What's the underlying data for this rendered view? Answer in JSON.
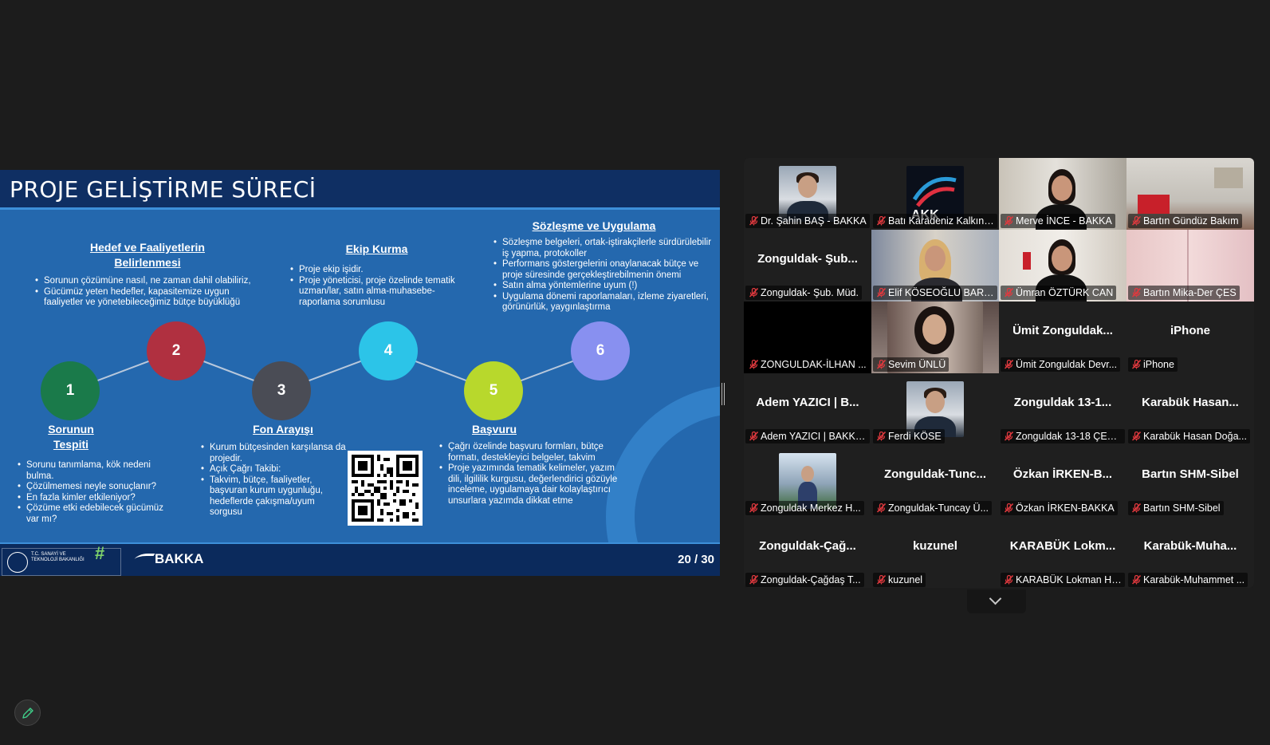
{
  "slide": {
    "title": "PROJE GELİŞTİRME SÜRECİ",
    "page": "20 / 30",
    "footer_ministry": "T.C. SANAYİ VE TEKNOLOJİ BAKANLIĞI",
    "footer_logo": "BAKKA",
    "steps": [
      {
        "num": "1",
        "title": "Sorunun Tespiti",
        "color": "#1a7a4a",
        "items": [
          "Sorunu tanımlama, kök nedeni bulma.",
          "Çözülmemesi neyle sonuçlanır?",
          "En fazla kimler etkileniyor?",
          "Çözüme etki edebilecek gücümüz var mı?"
        ]
      },
      {
        "num": "2",
        "title": "Hedef ve Faaliyetlerin Belirlenmesi",
        "color": "#b03040",
        "items": [
          "Sorunun çözümüne nasıl, ne zaman dahil olabiliriz,",
          "Gücümüz yeten hedefler, kapasitemize uygun faaliyetler ve yönetebileceğimiz bütçe büyüklüğü"
        ]
      },
      {
        "num": "3",
        "title": "Fon Arayışı",
        "color": "#4a4c55",
        "items": [
          "Kurum bütçesinden karşılansa da projedir.",
          "Açık Çağrı Takibi:",
          "Takvim, bütçe, faaliyetler, başvuran kurum uygunluğu, hedeflerde çakışma/uyum sorgusu"
        ]
      },
      {
        "num": "4",
        "title": "Ekip Kurma",
        "color": "#2cc4e8",
        "items": [
          "Proje ekip işidir.",
          "Proje yöneticisi, proje özelinde tematik uzman/lar, satın alma-muhasebe-raporlama sorumlusu"
        ]
      },
      {
        "num": "5",
        "title": "Başvuru",
        "color": "#b8d82c",
        "items": [
          "Çağrı özelinde başvuru formları, bütçe formatı, destekleyici belgeler, takvim",
          "Proje yazımında tematik kelimeler, yazım dili, ilgililik kurgusu, değerlendirici gözüyle inceleme, uygulamaya dair kolaylaştırıcı unsurlara yazımda dikkat etme"
        ]
      },
      {
        "num": "6",
        "title": "Sözleşme ve Uygulama",
        "color": "#8890f0",
        "items": [
          "Sözleşme belgeleri, ortak-iştirakçilerle sürdürülebilir iş yapma, protokoller",
          "Performans göstergelerini onaylanacak bütçe ve proje süresinde gerçekleştirebilmenin önemi",
          "Satın alma yöntemlerine uyum (!)",
          "Uygulama dönemi raporlamaları, izleme ziyaretleri, görünürlük, yaygınlaştırma"
        ]
      }
    ]
  },
  "participants": [
    {
      "big": "",
      "label": "Dr. Şahin BAŞ - BAKKA",
      "kind": "avatar-man"
    },
    {
      "big": "",
      "label": "Batı Karadeniz Kalkınma Ajansı",
      "kind": "logo"
    },
    {
      "big": "",
      "label": "Merve İNCE - BAKKA",
      "kind": "video-office"
    },
    {
      "big": "",
      "label": "Bartın Gündüz Bakım",
      "kind": "video-room"
    },
    {
      "big": "Zonguldak-  Şub...",
      "label": "Zonguldak- Şub. Müd.",
      "kind": "name"
    },
    {
      "big": "",
      "label": "Elif KÖSEOĞLU BARTIN",
      "kind": "video-woman"
    },
    {
      "big": "",
      "label": "Ümran ÖZTÜRK CAN",
      "kind": "video-active"
    },
    {
      "big": "",
      "label": "Bartın Mika-Der ÇES",
      "kind": "video-pink"
    },
    {
      "big": "",
      "label": "ZONGULDAK-İLHAN ...",
      "kind": "black"
    },
    {
      "big": "",
      "label": "Sevim ÜNLÜ",
      "kind": "video-sevim"
    },
    {
      "big": "Ümit  Zonguldak...",
      "label": "Ümit Zonguldak Devr...",
      "kind": "name"
    },
    {
      "big": "iPhone",
      "label": "iPhone",
      "kind": "name"
    },
    {
      "big": "Adem YAZICI | B...",
      "label": "Adem YAZICI | BAKKA...",
      "kind": "name"
    },
    {
      "big": "",
      "label": "Ferdi KÖSE",
      "kind": "avatar-man2"
    },
    {
      "big": "Zonguldak  13-1...",
      "label": "Zonguldak 13-18 ÇES...",
      "kind": "name"
    },
    {
      "big": "Karabük  Hasan...",
      "label": "Karabük Hasan Doğa...",
      "kind": "name"
    },
    {
      "big": "",
      "label": "Zonguldak Merkez H...",
      "kind": "avatar-outdoor"
    },
    {
      "big": "Zonguldak-Tunc...",
      "label": "Zonguldak-Tuncay Ü...",
      "kind": "name"
    },
    {
      "big": "Özkan  İRKEN-B...",
      "label": "Özkan İRKEN-BAKKA",
      "kind": "name"
    },
    {
      "big": "Bartın SHM-Sibel",
      "label": "Bartın SHM-Sibel",
      "kind": "name"
    },
    {
      "big": "Zonguldak-Çağ...",
      "label": "Zonguldak-Çağdaş T...",
      "kind": "name"
    },
    {
      "big": "kuzunel",
      "label": "kuzunel",
      "kind": "name"
    },
    {
      "big": "KARABÜK  Lokm...",
      "label": "KARABÜK Lokman HE...",
      "kind": "name"
    },
    {
      "big": "Karabük-Muha...",
      "label": "Karabük-Muhammet ...",
      "kind": "name"
    }
  ],
  "icons": {
    "mic": "muted-mic-icon",
    "chevron": "chevron-down-icon",
    "pen": "pen-icon"
  },
  "colors": {
    "active_speaker": "#35c27b",
    "muted": "#e0393e"
  }
}
